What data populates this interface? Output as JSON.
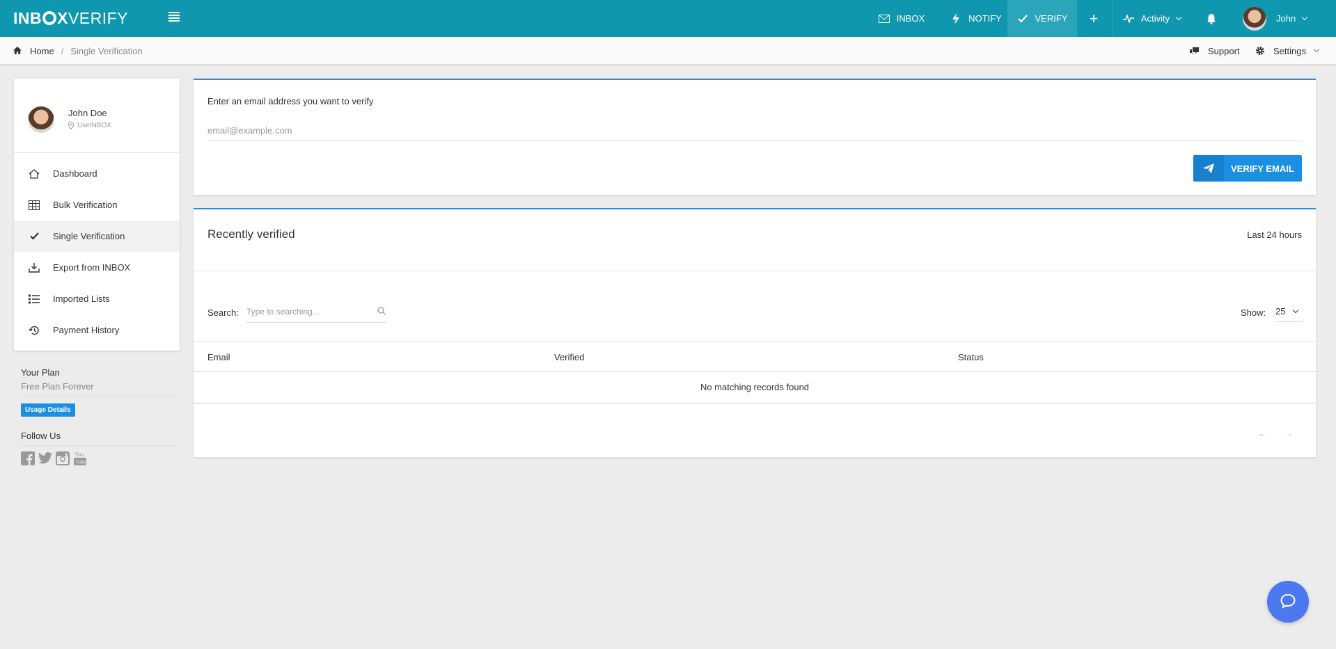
{
  "brand": {
    "logo_part1": "INB",
    "logo_part2": "X",
    "logo_part3": "VERIFY",
    "color": "#0e97ae"
  },
  "topnav": {
    "inbox": "INBOX",
    "notify": "NOTIFY",
    "verify": "VERIFY",
    "plus": "+",
    "activity": "Activity",
    "user": "John"
  },
  "breadcrumb": {
    "home": "Home",
    "separator": "/",
    "current": "Single Verification"
  },
  "utility": {
    "support": "Support",
    "settings": "Settings"
  },
  "profile": {
    "name": "John Doe",
    "org": "UseINBOX"
  },
  "sidebar": {
    "items": [
      {
        "label": "Dashboard",
        "icon": "home-icon"
      },
      {
        "label": "Bulk Verification",
        "icon": "table-icon"
      },
      {
        "label": "Single Verification",
        "icon": "check-icon",
        "active": true
      },
      {
        "label": "Export from INBOX",
        "icon": "download-tray-icon"
      },
      {
        "label": "Imported Lists",
        "icon": "list-icon"
      },
      {
        "label": "Payment History",
        "icon": "history-icon"
      }
    ]
  },
  "plan": {
    "heading": "Your Plan",
    "name": "Free Plan Forever",
    "usage_button": "Usage Details"
  },
  "follow": {
    "heading": "Follow Us",
    "networks": [
      "facebook-icon",
      "twitter-icon",
      "instagram-icon",
      "youtube-icon"
    ]
  },
  "verify": {
    "label": "Enter an email address you want to verify",
    "placeholder": "email@example.com",
    "value": "",
    "button": "VERIFY EMAIL"
  },
  "recent": {
    "title": "Recently verified",
    "range": "Last 24 hours",
    "search_label": "Search:",
    "search_placeholder": "Type to searching...",
    "show_label": "Show:",
    "show_value": "25",
    "columns": [
      "Email",
      "Verified",
      "Status"
    ],
    "empty_message": "No matching records found",
    "prev": "←",
    "next": "→"
  },
  "colors": {
    "accent": "#1b8fe4",
    "card_border": "#2f89d8",
    "chat": "#4c78f0"
  }
}
